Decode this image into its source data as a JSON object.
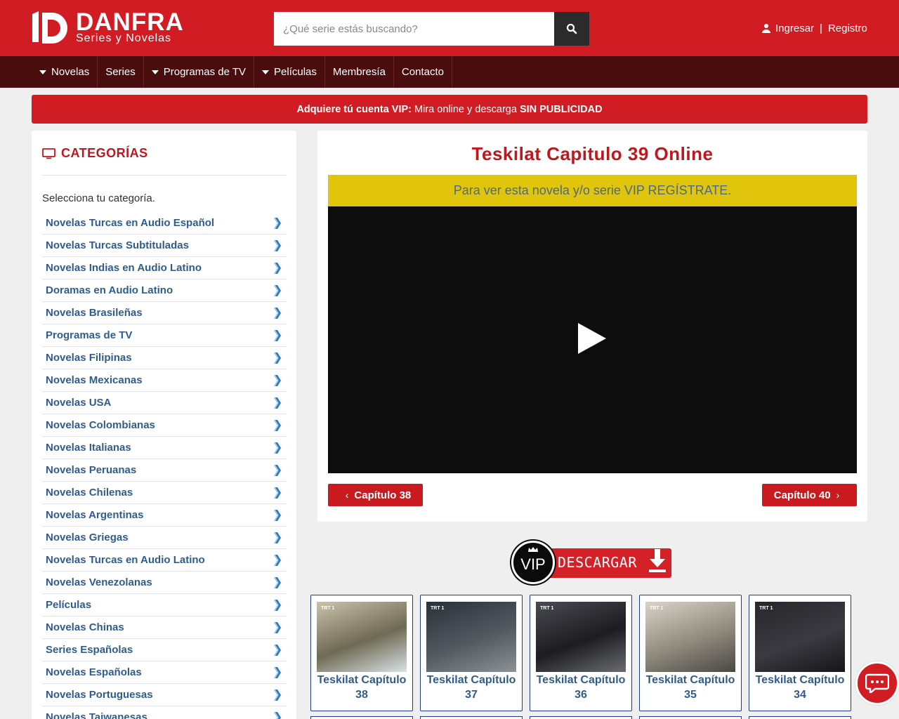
{
  "brand": {
    "name": "DANFRA",
    "tagline": "Series y Novelas",
    "color": "#d01c22"
  },
  "search": {
    "placeholder": "¿Qué serie estás buscando?",
    "icon": "search-icon"
  },
  "account": {
    "login": "Ingresar",
    "separator": "|",
    "register": "Registro",
    "icon": "user-icon"
  },
  "nav": {
    "items": [
      {
        "label": "Novelas",
        "dropdown": true
      },
      {
        "label": "Series",
        "dropdown": false
      },
      {
        "label": "Programas de TV",
        "dropdown": true
      },
      {
        "label": "Películas",
        "dropdown": true
      },
      {
        "label": "Membresía",
        "dropdown": false
      },
      {
        "label": "Contacto",
        "dropdown": false
      }
    ]
  },
  "vip_banner": {
    "bold_1": "Adquiere tú cuenta VIP:",
    "normal": " Mira online y descarga ",
    "bold_2": "SIN PUBLICIDAD"
  },
  "sidebar": {
    "heading": "CATEGORÍAS",
    "heading_icon": "monitor-icon",
    "intro": "Selecciona tu categoría.",
    "categories": [
      "Novelas Turcas en Audio Español",
      "Novelas Turcas Subtituladas",
      "Novelas Indias en Audio Latino",
      "Doramas en Audio Latino",
      "Novelas Brasileñas",
      "Programas de TV",
      "Novelas Filipinas",
      "Novelas Mexicanas",
      "Novelas USA",
      "Novelas Colombianas",
      "Novelas Italianas",
      "Novelas Peruanas",
      "Novelas Chilenas",
      "Novelas Argentinas",
      "Novelas Griegas",
      "Novelas Turcas en Audio Latino",
      "Novelas Venezolanas",
      "Películas",
      "Novelas Chinas",
      "Series Españolas",
      "Novelas Españolas",
      "Novelas Portuguesas",
      "Novelas Taiwanesas"
    ]
  },
  "episode": {
    "title": "Teskilat Capitulo 39 Online",
    "vip_notice": "Para ver esta novela y/o serie VIP REGÍSTRATE.",
    "prev_label": "Capítulo 38",
    "next_label": "Capítulo 40"
  },
  "vip_download": {
    "badge": "VIP",
    "label": "DESCARGAR"
  },
  "related": [
    {
      "line1": "Teskilat Capítulo",
      "line2": "38",
      "channel": "TRT 1"
    },
    {
      "line1": "Teskilat Capítulo",
      "line2": "37",
      "channel": "TRT 1"
    },
    {
      "line1": "Teskilat Capítulo",
      "line2": "36",
      "channel": "TRT 1"
    },
    {
      "line1": "Teskilat Capítulo",
      "line2": "35",
      "channel": "TRT 1"
    },
    {
      "line1": "Teskilat Capítulo",
      "line2": "34",
      "channel": "TRT 1"
    }
  ]
}
